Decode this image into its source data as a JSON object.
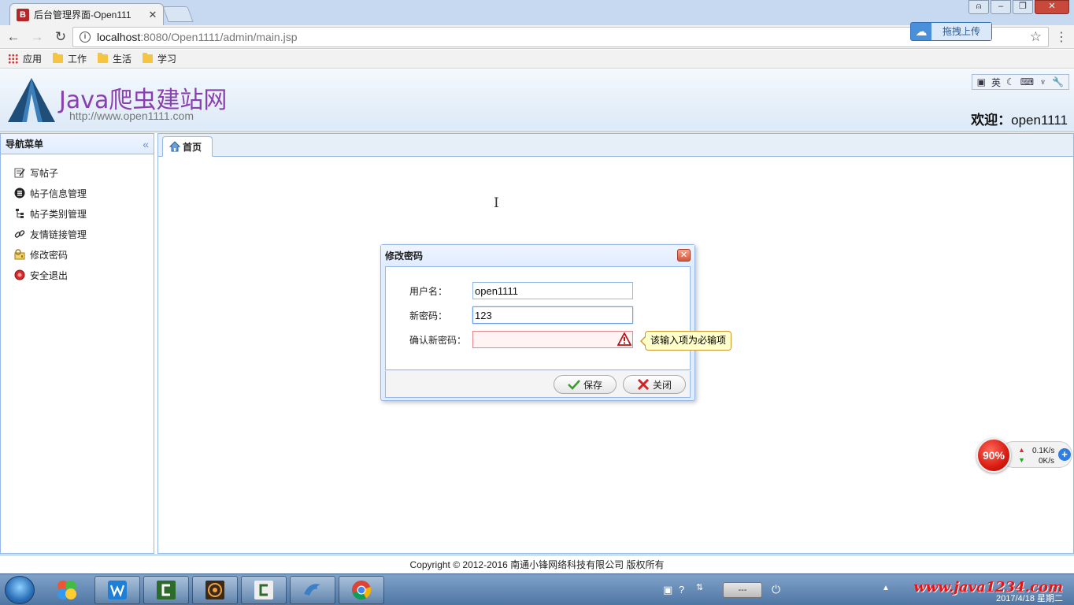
{
  "browser": {
    "tab_title": "后台管理界面-Open111",
    "tab_favicon_letter": "B",
    "url_host": "localhost",
    "url_path": ":8080/Open1111/admin/main.jsp",
    "upload_label": "拖拽上传",
    "bookmarks": [
      "应用",
      "工作",
      "生活",
      "学习"
    ]
  },
  "header": {
    "logo_title": "Java爬虫建站网",
    "logo_url": "http://www.open1111.com",
    "sys_tools": [
      "英"
    ],
    "welcome_prefix": "欢迎：",
    "welcome_user": "open1111"
  },
  "nav": {
    "title": "导航菜单",
    "items": [
      {
        "label": "写帖子",
        "icon": "edit-icon"
      },
      {
        "label": "帖子信息管理",
        "icon": "list-icon"
      },
      {
        "label": "帖子类别管理",
        "icon": "tree-icon"
      },
      {
        "label": "友情链接管理",
        "icon": "link-icon"
      },
      {
        "label": "修改密码",
        "icon": "key-icon"
      },
      {
        "label": "安全退出",
        "icon": "exit-icon"
      }
    ]
  },
  "main": {
    "tab_label": "首页"
  },
  "dialog": {
    "title": "修改密码",
    "fields": [
      {
        "label": "用户名：",
        "value": "open1111"
      },
      {
        "label": "新密码：",
        "value": "123"
      },
      {
        "label": "确认新密码：",
        "value": ""
      }
    ],
    "tooltip": "该输入项为必输项",
    "save_label": "保存",
    "close_label": "关闭"
  },
  "footer": {
    "text": "Copyright © 2012-2016 南通小锋网络科技有限公司 版权所有"
  },
  "speed_widget": {
    "percent": "90%",
    "up": "0.1K/s",
    "down": "0K/s"
  },
  "taskbar": {
    "input_indicator": "---",
    "watermark": "www.java1234.com",
    "clock_date": "2017/4/18 星期二"
  },
  "colors": {
    "panel_border": "#95b8e7",
    "header_bg": "#dce9f7",
    "logo_text": "#8a3fb0",
    "invalid_bg": "#fff3f3",
    "tooltip_bg": "#ffffcc"
  }
}
